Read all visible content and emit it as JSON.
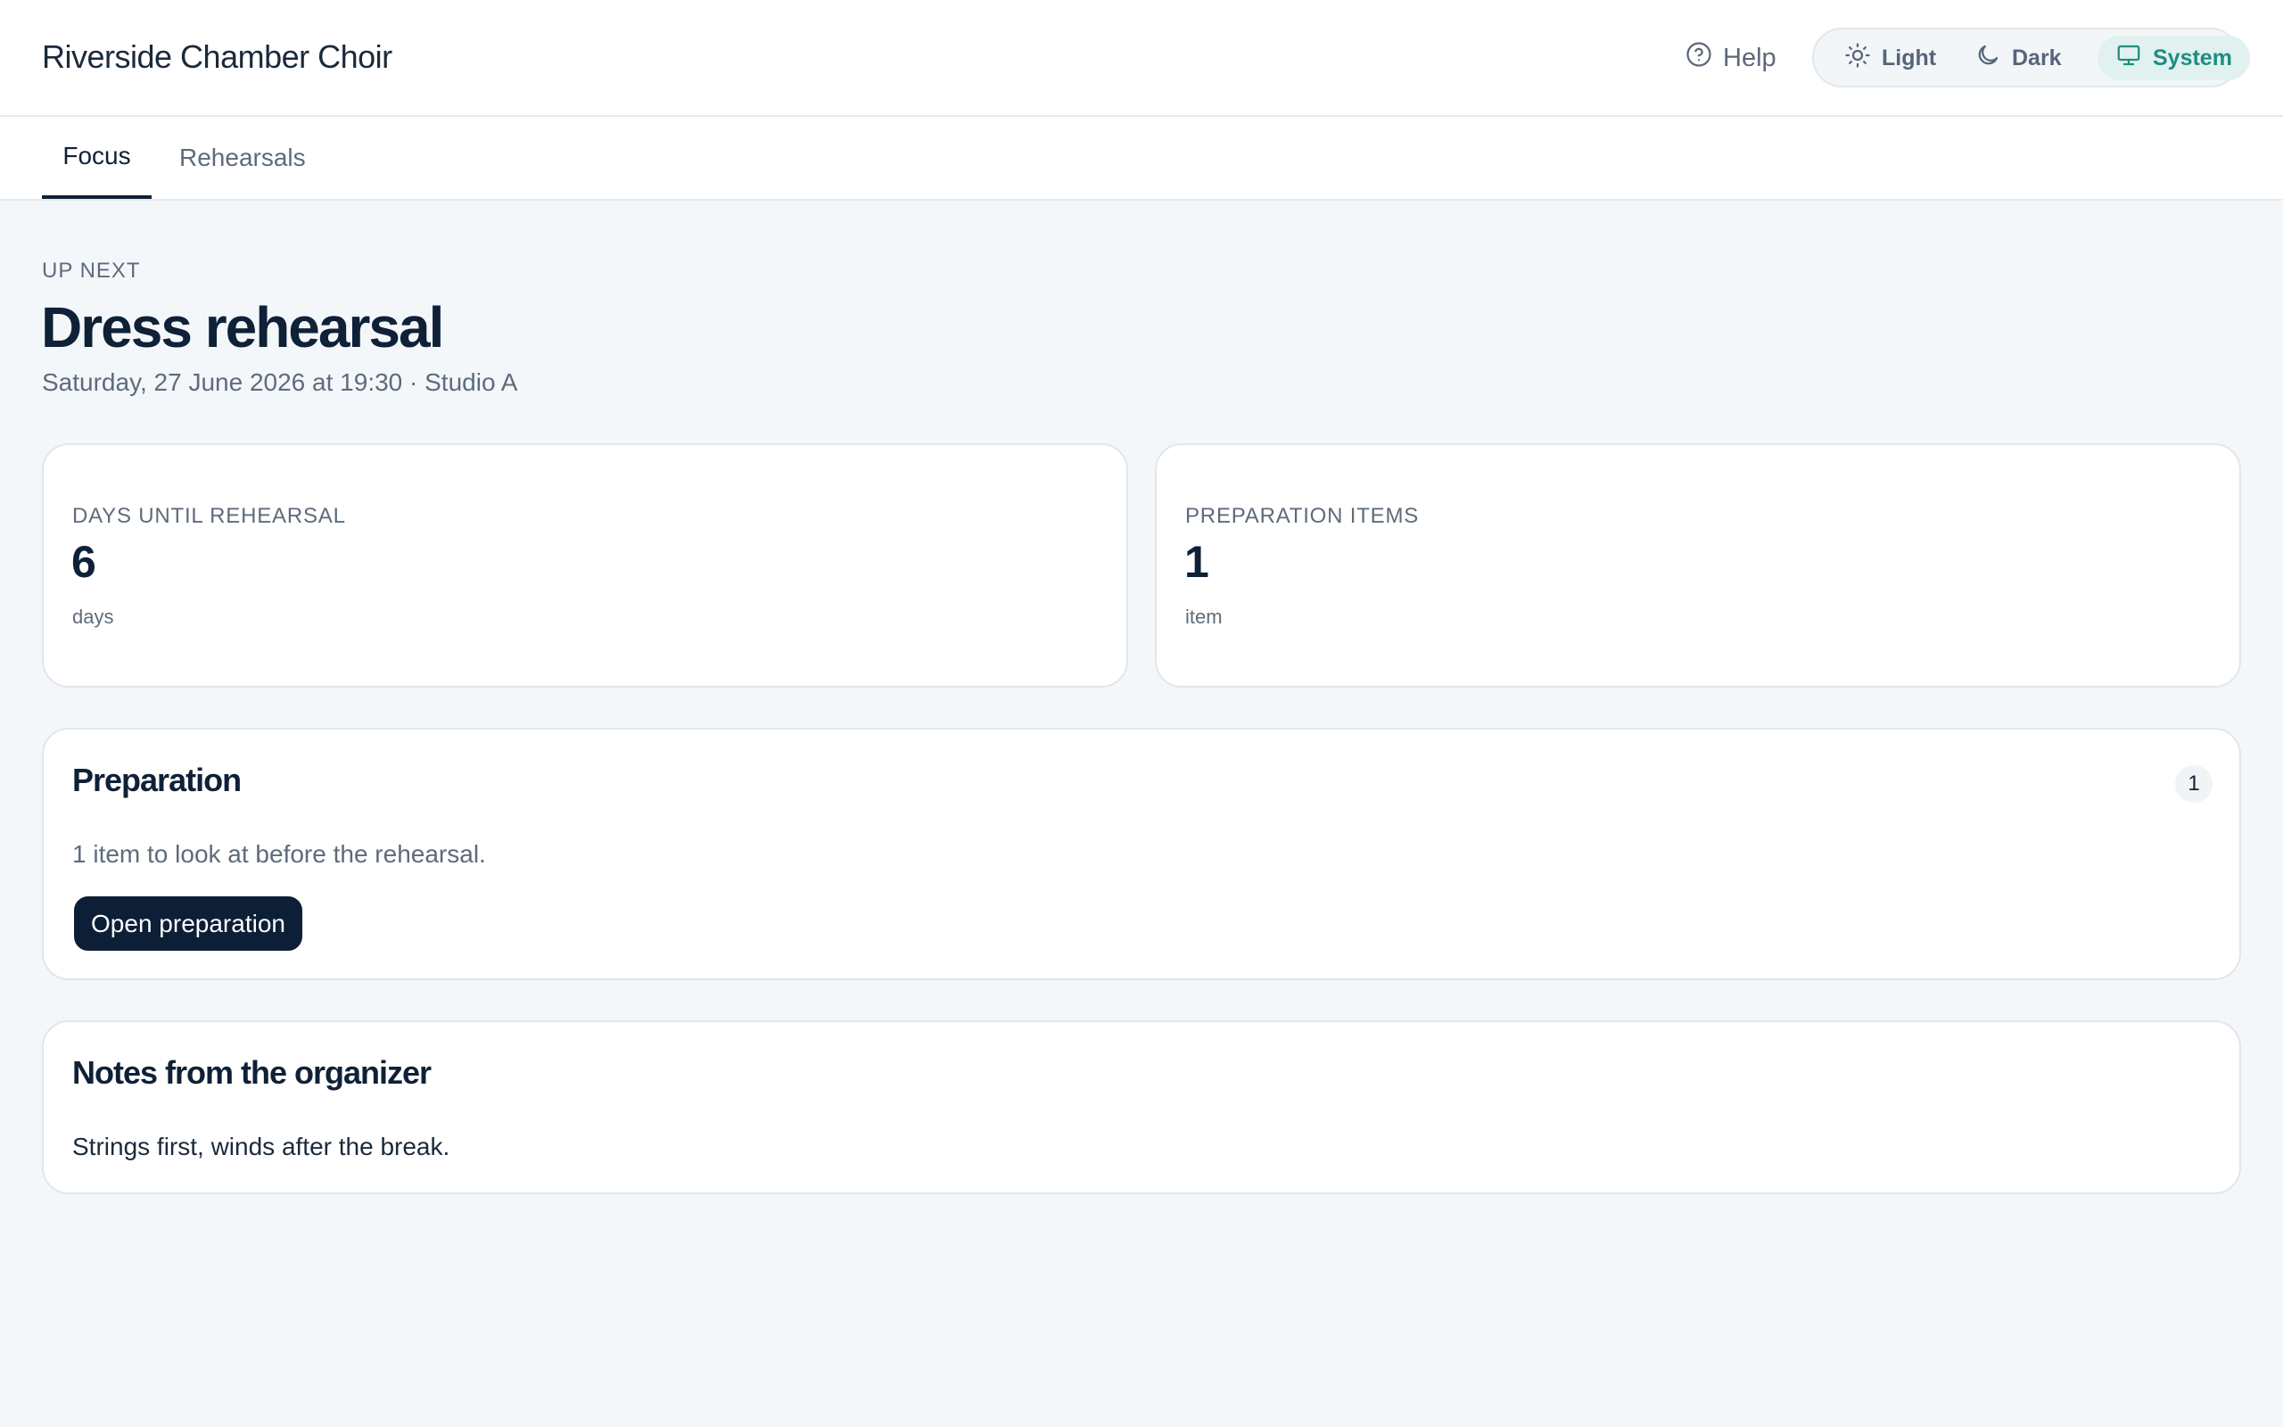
{
  "header": {
    "app_title": "Riverside Chamber Choir",
    "help_label": "Help",
    "help_icon": "question-circle-icon",
    "theme": {
      "options": [
        {
          "label": "Light",
          "icon": "sun-icon"
        },
        {
          "label": "Dark",
          "icon": "moon-icon"
        },
        {
          "label": "System",
          "icon": "monitor-icon"
        }
      ],
      "selected": "System"
    }
  },
  "tabs": [
    {
      "label": "Focus",
      "active": true
    },
    {
      "label": "Rehearsals",
      "active": false
    }
  ],
  "hero": {
    "eyebrow": "UP NEXT",
    "title": "Dress rehearsal",
    "subtitle": "Saturday, 27 June 2026 at 19:30 · Studio A"
  },
  "stats": [
    {
      "label": "DAYS UNTIL REHEARSAL",
      "value": "6",
      "unit": "days"
    },
    {
      "label": "PREPARATION ITEMS",
      "value": "1",
      "unit": "item"
    }
  ],
  "preparation": {
    "title": "Preparation",
    "count": "1",
    "text": "1 item to look at before the rehearsal.",
    "button_label": "Open preparation"
  },
  "notes": {
    "title": "Notes from the organizer",
    "text": "Strings first, winds after the break."
  },
  "colors": {
    "accent": "#1d8e7f",
    "primary_button": "#0c1f36",
    "background": "#f4f7fa"
  }
}
